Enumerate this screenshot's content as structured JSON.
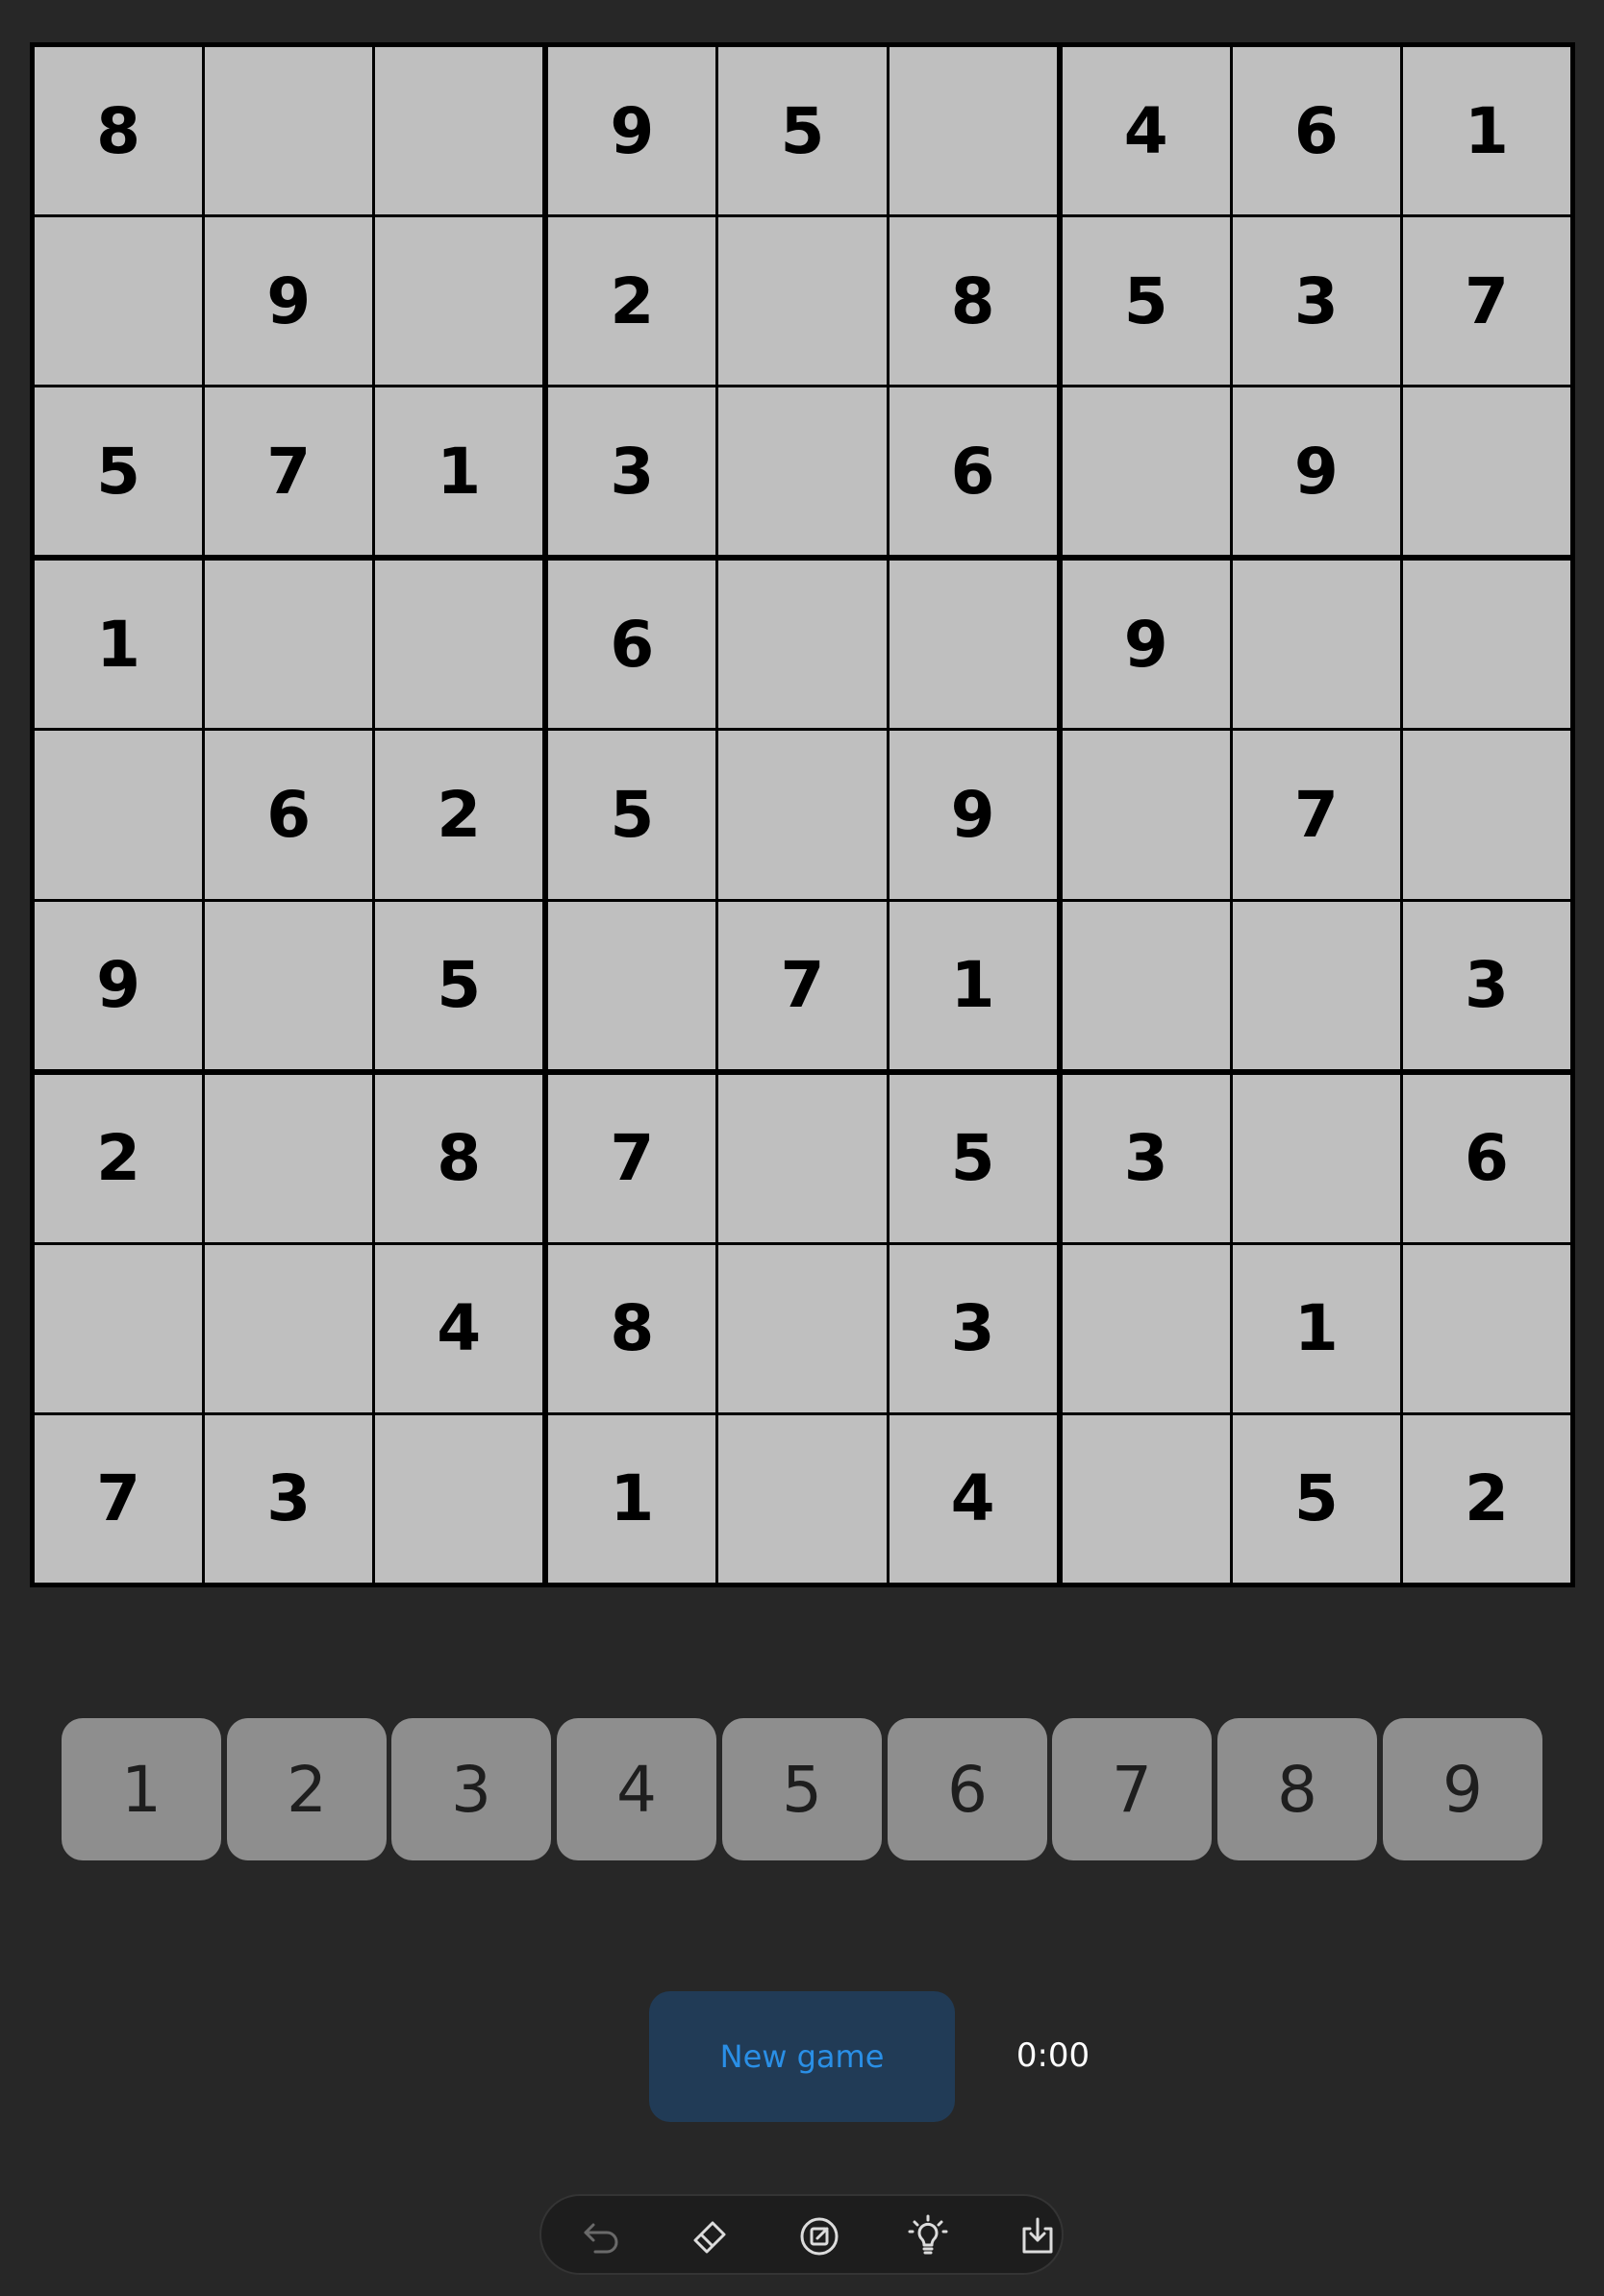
{
  "board": {
    "grid": [
      [
        8,
        null,
        null,
        9,
        5,
        null,
        4,
        6,
        1
      ],
      [
        null,
        9,
        null,
        2,
        null,
        8,
        5,
        3,
        7
      ],
      [
        5,
        7,
        1,
        3,
        null,
        6,
        null,
        9,
        null
      ],
      [
        1,
        null,
        null,
        6,
        null,
        null,
        9,
        null,
        null
      ],
      [
        null,
        6,
        2,
        5,
        null,
        9,
        null,
        7,
        null
      ],
      [
        9,
        null,
        5,
        null,
        7,
        1,
        null,
        null,
        3
      ],
      [
        2,
        null,
        8,
        7,
        null,
        5,
        3,
        null,
        6
      ],
      [
        null,
        null,
        4,
        8,
        null,
        3,
        null,
        1,
        null
      ],
      [
        7,
        3,
        null,
        1,
        null,
        4,
        null,
        5,
        2
      ]
    ]
  },
  "numpad": {
    "keys": [
      "1",
      "2",
      "3",
      "4",
      "5",
      "6",
      "7",
      "8",
      "9"
    ]
  },
  "controls": {
    "new_game_label": "New game",
    "timer": "0:00"
  },
  "toolbar": {
    "tools": [
      "undo-icon",
      "eraser-icon",
      "notes-icon",
      "hint-icon",
      "save-icon"
    ]
  },
  "colors": {
    "background": "#272727",
    "cell": "#bfbfbf",
    "digit": "#000000",
    "key": "#8e8e8e",
    "new_game_bg": "#213b56",
    "new_game_text": "#2a8fe6"
  }
}
